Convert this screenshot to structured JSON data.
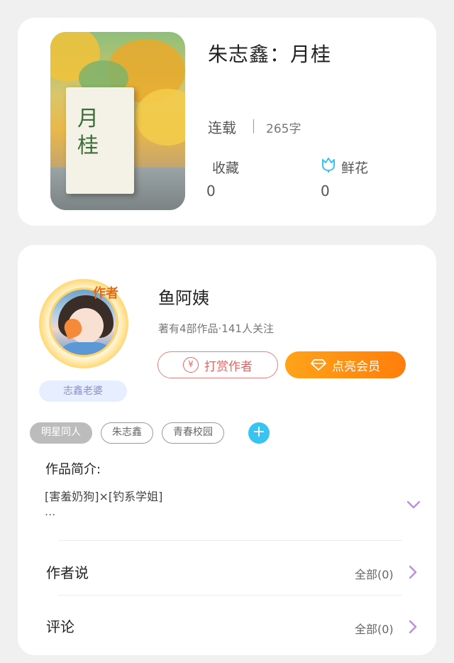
{
  "book": {
    "title": "朱志鑫：月桂",
    "cover_title": "月桂",
    "status": "连载",
    "word_count": "265字",
    "favorites_label": "收藏",
    "favorites_value": "0",
    "flowers_label": "鲜花",
    "flowers_value": "0",
    "flower_icon": "tulip-icon"
  },
  "author": {
    "badge": "作者",
    "name": "鱼阿姨",
    "stats": "著有4部作品·141人关注",
    "title_tag": "志鑫老婆",
    "reward_label": "打赏作者",
    "vip_label": "点亮会员"
  },
  "tags": [
    "明星同人",
    "朱志鑫",
    "青春校园"
  ],
  "intro": {
    "heading": "作品简介:",
    "text": "[害羞奶狗]×[钓系学姐]",
    "ellipsis": "..."
  },
  "rows": [
    {
      "label": "作者说",
      "right": "全部(0)"
    },
    {
      "label": "评论",
      "right": "全部(0)"
    }
  ],
  "colors": {
    "accent_orange": "#ff8a0f",
    "reward_red": "#e56565",
    "chevron_purple": "#b98ee0",
    "add_blue": "#39c3f0"
  }
}
